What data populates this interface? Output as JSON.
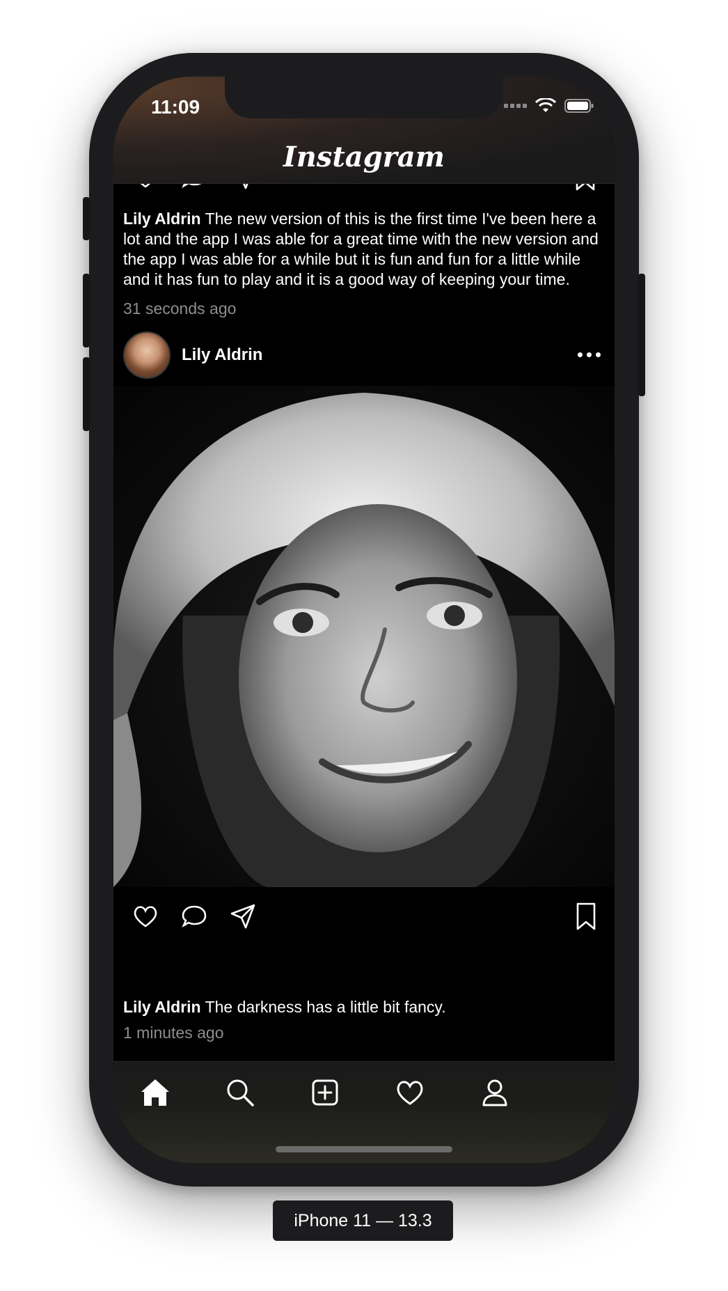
{
  "status_bar": {
    "time": "11:09"
  },
  "header": {
    "title": "Instagram"
  },
  "feed": {
    "previous_post": {
      "caption_user": "Lily Aldrin",
      "caption_text": "The new version of this is the first time I've been here a lot and the app I was able for a great time with the new version and the app I was able for a while but it is fun and fun for a little while and it has fun to play and it is a good way of keeping your time.",
      "time_ago": "31 seconds ago"
    },
    "post": {
      "username": "Lily Aldrin",
      "caption_user": "Lily Aldrin",
      "caption_text": "The darkness has a little bit fancy.",
      "time_ago": "1 minutes ago"
    }
  },
  "tabbar": {
    "items": [
      {
        "icon": "home-icon"
      },
      {
        "icon": "search-icon"
      },
      {
        "icon": "add-post-icon"
      },
      {
        "icon": "heart-icon"
      },
      {
        "icon": "profile-icon"
      }
    ]
  },
  "device_label": "iPhone 11 — 13.3"
}
